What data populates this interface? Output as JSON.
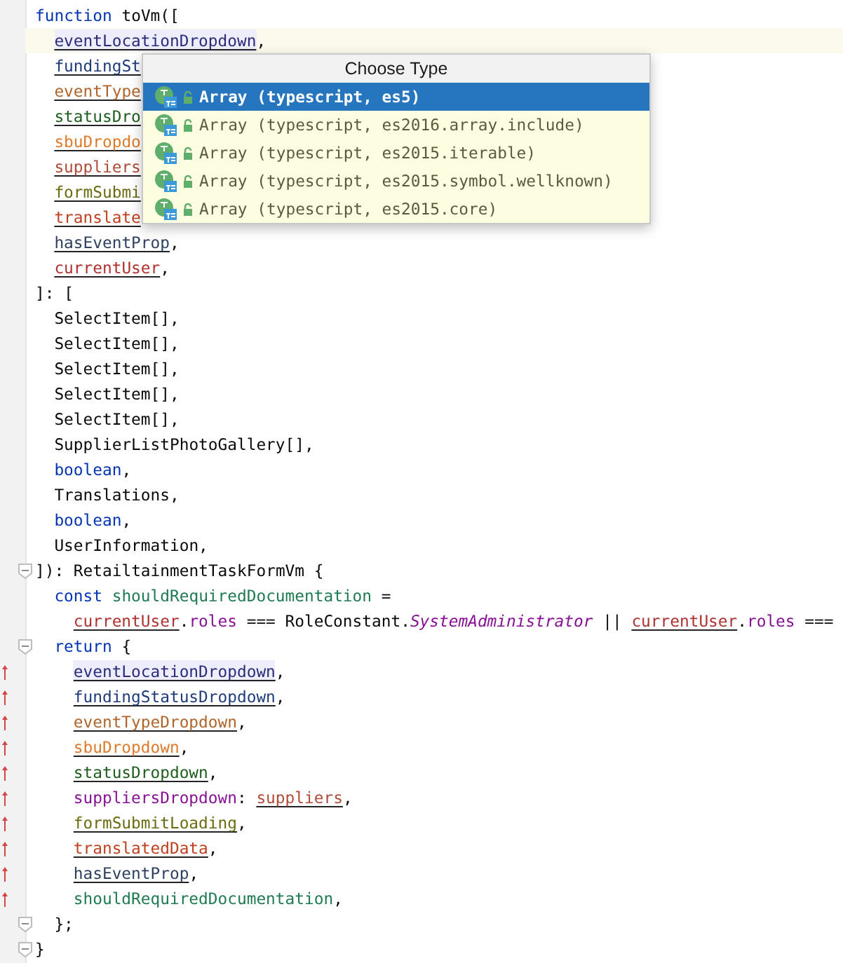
{
  "editor": {
    "lines": [
      {
        "tokens": [
          {
            "text": "function",
            "kind": "keyword"
          },
          {
            "text": " toVm([",
            "kind": "plain"
          }
        ],
        "children": [
          {
            "caret_line": true,
            "tokens": [
              {
                "text": "eventLocationDropdown",
                "kind": "param",
                "color": "#2b2b7a",
                "highlighted": true
              },
              {
                "text": ",",
                "kind": "plain"
              }
            ]
          },
          {
            "tokens": [
              {
                "text": "fundingSt",
                "kind": "param",
                "color": "#1e3a7a"
              }
            ]
          },
          {
            "tokens": [
              {
                "text": "eventType",
                "kind": "param",
                "color": "#b0642a"
              }
            ]
          },
          {
            "tokens": [
              {
                "text": "statusDro",
                "kind": "param",
                "color": "#1d5c1d"
              }
            ]
          },
          {
            "tokens": [
              {
                "text": "sbuDropdo",
                "kind": "param",
                "color": "#e07a2a"
              }
            ]
          },
          {
            "tokens": [
              {
                "text": "suppliers",
                "kind": "param",
                "color": "#b24a3a"
              }
            ]
          },
          {
            "tokens": [
              {
                "text": "formSubmi",
                "kind": "param",
                "color": "#6b6b10"
              }
            ]
          },
          {
            "tokens": [
              {
                "text": "translate",
                "kind": "param",
                "color": "#c0401f"
              }
            ]
          },
          {
            "tokens": [
              {
                "text": "hasEventProp",
                "kind": "param",
                "color": "#2d4060"
              },
              {
                "text": ",",
                "kind": "plain"
              }
            ]
          },
          {
            "tokens": [
              {
                "text": "currentUser",
                "kind": "param",
                "color": "#b03030"
              },
              {
                "text": ",",
                "kind": "plain"
              }
            ]
          }
        ]
      },
      {
        "tokens": [
          {
            "text": "]: [",
            "kind": "plain"
          }
        ],
        "children": [
          {
            "tokens": [
              {
                "text": "SelectItem[],",
                "kind": "plain"
              }
            ]
          },
          {
            "tokens": [
              {
                "text": "SelectItem[],",
                "kind": "plain"
              }
            ]
          },
          {
            "tokens": [
              {
                "text": "SelectItem[],",
                "kind": "plain"
              }
            ]
          },
          {
            "tokens": [
              {
                "text": "SelectItem[],",
                "kind": "plain"
              }
            ]
          },
          {
            "tokens": [
              {
                "text": "SelectItem[],",
                "kind": "plain"
              }
            ]
          },
          {
            "tokens": [
              {
                "text": "SupplierListPhotoGallery[],",
                "kind": "plain"
              }
            ]
          },
          {
            "tokens": [
              {
                "text": "boolean",
                "kind": "keyword"
              },
              {
                "text": ",",
                "kind": "plain"
              }
            ]
          },
          {
            "tokens": [
              {
                "text": "Translations,",
                "kind": "plain"
              }
            ]
          },
          {
            "tokens": [
              {
                "text": "boolean",
                "kind": "keyword"
              },
              {
                "text": ",",
                "kind": "plain"
              }
            ]
          },
          {
            "tokens": [
              {
                "text": "UserInformation,",
                "kind": "plain"
              }
            ]
          }
        ]
      },
      {
        "fold_marker": true,
        "tokens": [
          {
            "text": "]): RetailtainmentTaskFormVm {",
            "kind": "plain"
          }
        ],
        "children": [
          {
            "tokens": [
              {
                "text": "const ",
                "kind": "keyword"
              },
              {
                "text": "shouldRequiredDocumentation",
                "kind": "local"
              },
              {
                "text": " =",
                "kind": "plain"
              }
            ],
            "children": [
              {
                "tokens": [
                  {
                    "text": "currentUser",
                    "kind": "param",
                    "color": "#b03030"
                  },
                  {
                    "text": ".",
                    "kind": "plain"
                  },
                  {
                    "text": "roles",
                    "kind": "property"
                  },
                  {
                    "text": " === RoleConstant.",
                    "kind": "plain"
                  },
                  {
                    "text": "SystemAdministrator",
                    "kind": "static"
                  },
                  {
                    "text": " || ",
                    "kind": "plain"
                  },
                  {
                    "text": "currentUser",
                    "kind": "param",
                    "color": "#b03030"
                  },
                  {
                    "text": ".",
                    "kind": "plain"
                  },
                  {
                    "text": "roles",
                    "kind": "property"
                  },
                  {
                    "text": " ===",
                    "kind": "plain"
                  }
                ]
              }
            ]
          },
          {
            "fold_marker": true,
            "tokens": [
              {
                "text": "return",
                "kind": "keyword"
              },
              {
                "text": " {",
                "kind": "plain"
              }
            ],
            "children": [
              {
                "change_marker": true,
                "tokens": [
                  {
                    "text": "eventLocationDropdown",
                    "kind": "param",
                    "color": "#2b2b7a",
                    "highlighted": true
                  },
                  {
                    "text": ",",
                    "kind": "plain"
                  }
                ]
              },
              {
                "change_marker": true,
                "tokens": [
                  {
                    "text": "fundingStatusDropdown",
                    "kind": "param",
                    "color": "#1e3a7a"
                  },
                  {
                    "text": ",",
                    "kind": "plain"
                  }
                ]
              },
              {
                "change_marker": true,
                "tokens": [
                  {
                    "text": "eventTypeDropdown",
                    "kind": "param",
                    "color": "#b0642a"
                  },
                  {
                    "text": ",",
                    "kind": "plain"
                  }
                ]
              },
              {
                "change_marker": true,
                "tokens": [
                  {
                    "text": "sbuDropdown",
                    "kind": "param",
                    "color": "#e07a2a"
                  },
                  {
                    "text": ",",
                    "kind": "plain"
                  }
                ]
              },
              {
                "change_marker": true,
                "tokens": [
                  {
                    "text": "statusDropdown",
                    "kind": "param",
                    "color": "#1d5c1d"
                  },
                  {
                    "text": ",",
                    "kind": "plain"
                  }
                ]
              },
              {
                "change_marker": true,
                "tokens": [
                  {
                    "text": "suppliersDropdown",
                    "kind": "property"
                  },
                  {
                    "text": ": ",
                    "kind": "plain"
                  },
                  {
                    "text": "suppliers",
                    "kind": "param",
                    "color": "#b24a3a"
                  },
                  {
                    "text": ",",
                    "kind": "plain"
                  }
                ]
              },
              {
                "change_marker": true,
                "tokens": [
                  {
                    "text": "formSubmitLoading",
                    "kind": "param",
                    "color": "#6b6b10"
                  },
                  {
                    "text": ",",
                    "kind": "plain"
                  }
                ]
              },
              {
                "change_marker": true,
                "tokens": [
                  {
                    "text": "translatedData",
                    "kind": "param",
                    "color": "#c0401f"
                  },
                  {
                    "text": ",",
                    "kind": "plain"
                  }
                ]
              },
              {
                "change_marker": true,
                "tokens": [
                  {
                    "text": "hasEventProp",
                    "kind": "param",
                    "color": "#2d4060"
                  },
                  {
                    "text": ",",
                    "kind": "plain"
                  }
                ]
              },
              {
                "change_marker": true,
                "tokens": [
                  {
                    "text": "shouldRequiredDocumentation",
                    "kind": "local"
                  },
                  {
                    "text": ",",
                    "kind": "plain"
                  }
                ]
              }
            ]
          },
          {
            "fold_marker": true,
            "tokens": [
              {
                "text": "};",
                "kind": "plain"
              }
            ]
          }
        ]
      },
      {
        "fold_marker": true,
        "tokens": [
          {
            "text": "}",
            "kind": "plain"
          }
        ]
      }
    ]
  },
  "popup": {
    "title": "Choose Type",
    "items": [
      {
        "label": "Array (typescript, es5)",
        "selected": true
      },
      {
        "label": "Array (typescript, es2016.array.include)",
        "selected": false
      },
      {
        "label": "Array (typescript, es2015.iterable)",
        "selected": false
      },
      {
        "label": "Array (typescript, es2015.symbol.wellknown)",
        "selected": false
      },
      {
        "label": "Array (typescript, es2015.core)",
        "selected": false
      }
    ]
  }
}
